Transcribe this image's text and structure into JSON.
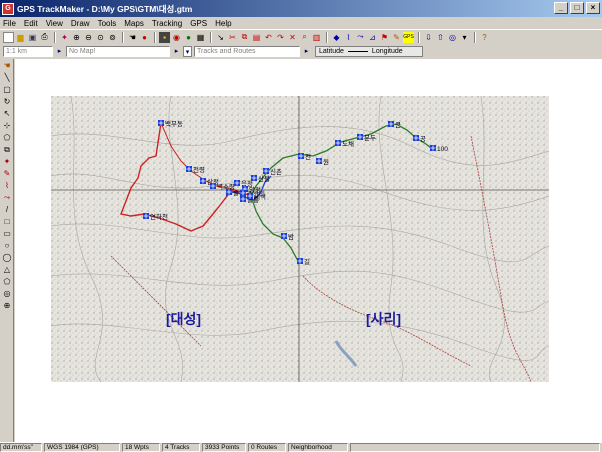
{
  "window": {
    "title": "GPS TrackMaker - D:\\My GPS\\GTM\\대성.gtm",
    "app_icon": "gps-trackmaker-icon"
  },
  "menu": [
    "File",
    "Edit",
    "View",
    "Draw",
    "Tools",
    "Maps",
    "Tracking",
    "GPS",
    "Help"
  ],
  "toolbar2": {
    "scale_value": "1:1 km",
    "map_value": "No Map!",
    "tracks_value": "Tracks and Routes",
    "latitude_label": "Latitude",
    "longitude_label": "Longitude"
  },
  "map": {
    "region_labels": [
      "[대성]",
      "[사리]"
    ],
    "waypoints": [
      "백무동",
      "천령",
      "삼정",
      "벽소령",
      "연하천",
      "음정",
      "물통",
      "양정",
      "산불",
      "밤",
      "신촌",
      "전",
      "원",
      "도채",
      "분두",
      "큰",
      "공",
      "길",
      "주산리",
      "세석",
      "솔",
      "100"
    ],
    "colors": {
      "red_track": "#cc2222",
      "green_track": "#2a7a2a",
      "blue_track": "#2244cc",
      "waypoint": "#1a3fd8",
      "region_label": "#1a1a9a"
    }
  },
  "statusbar": {
    "format": "dd.mm'ss\"",
    "datum": "WGS 1984 (GPS)",
    "wpts": "18 Wpts",
    "tracks": "4 Tracks",
    "points": "3933 Points",
    "routes": "0 Routes",
    "neighborhood": "Neighborhood"
  }
}
